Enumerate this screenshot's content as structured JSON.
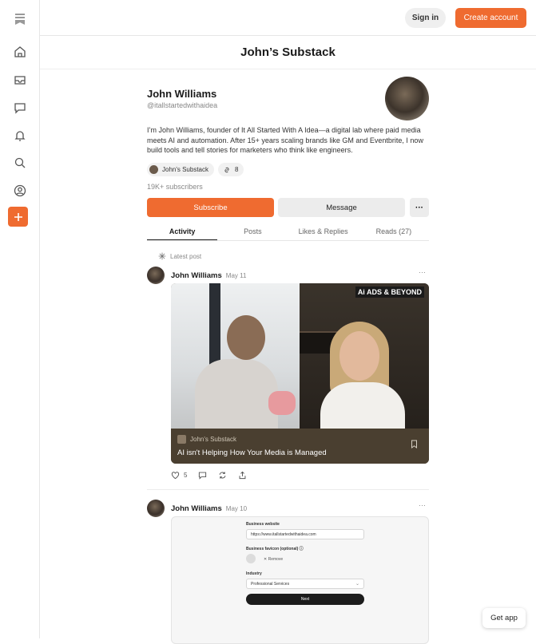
{
  "header": {
    "signin_label": "Sign in",
    "create_label": "Create account"
  },
  "publication": {
    "title": "John’s Substack"
  },
  "profile": {
    "name": "John Williams",
    "handle": "@itallstartedwithaidea",
    "bio": "I’m John Williams, founder of It All Started With A Idea—a digital lab where paid media meets AI and automation. After 15+ years scaling brands like GM and Eventbrite, I now build tools and tell stories for marketers who think like engineers.",
    "chip_pub": "John's Substack",
    "chip_links_count": "8",
    "subscribers": "19K+ subscribers",
    "subscribe_label": "Subscribe",
    "message_label": "Message",
    "more_label": "···"
  },
  "tabs": [
    "Activity",
    "Posts",
    "Likes & Replies",
    "Reads (27)"
  ],
  "feed": {
    "latest_label": "Latest post",
    "post1": {
      "author": "John Williams",
      "date": "May 11",
      "video_logo": "Ai ADS & BEYOND",
      "pub": "John's Substack",
      "title": "AI isn't Helping How Your Media is Managed",
      "likes": "5"
    },
    "post2": {
      "author": "John Williams",
      "date": "May 10",
      "form": {
        "website_label": "Business website",
        "website_value": "https://www.itallstartedwithaidea.com",
        "favicon_label": "Business favicon (optional) ⓘ",
        "remove_label": "✕  Remove",
        "industry_label": "Industry",
        "industry_value": "Professional Services",
        "next_label": "Next"
      }
    }
  },
  "getapp_label": "Get app",
  "colors": {
    "accent": "#ef6b30",
    "card_bg": "#4a3f30"
  }
}
